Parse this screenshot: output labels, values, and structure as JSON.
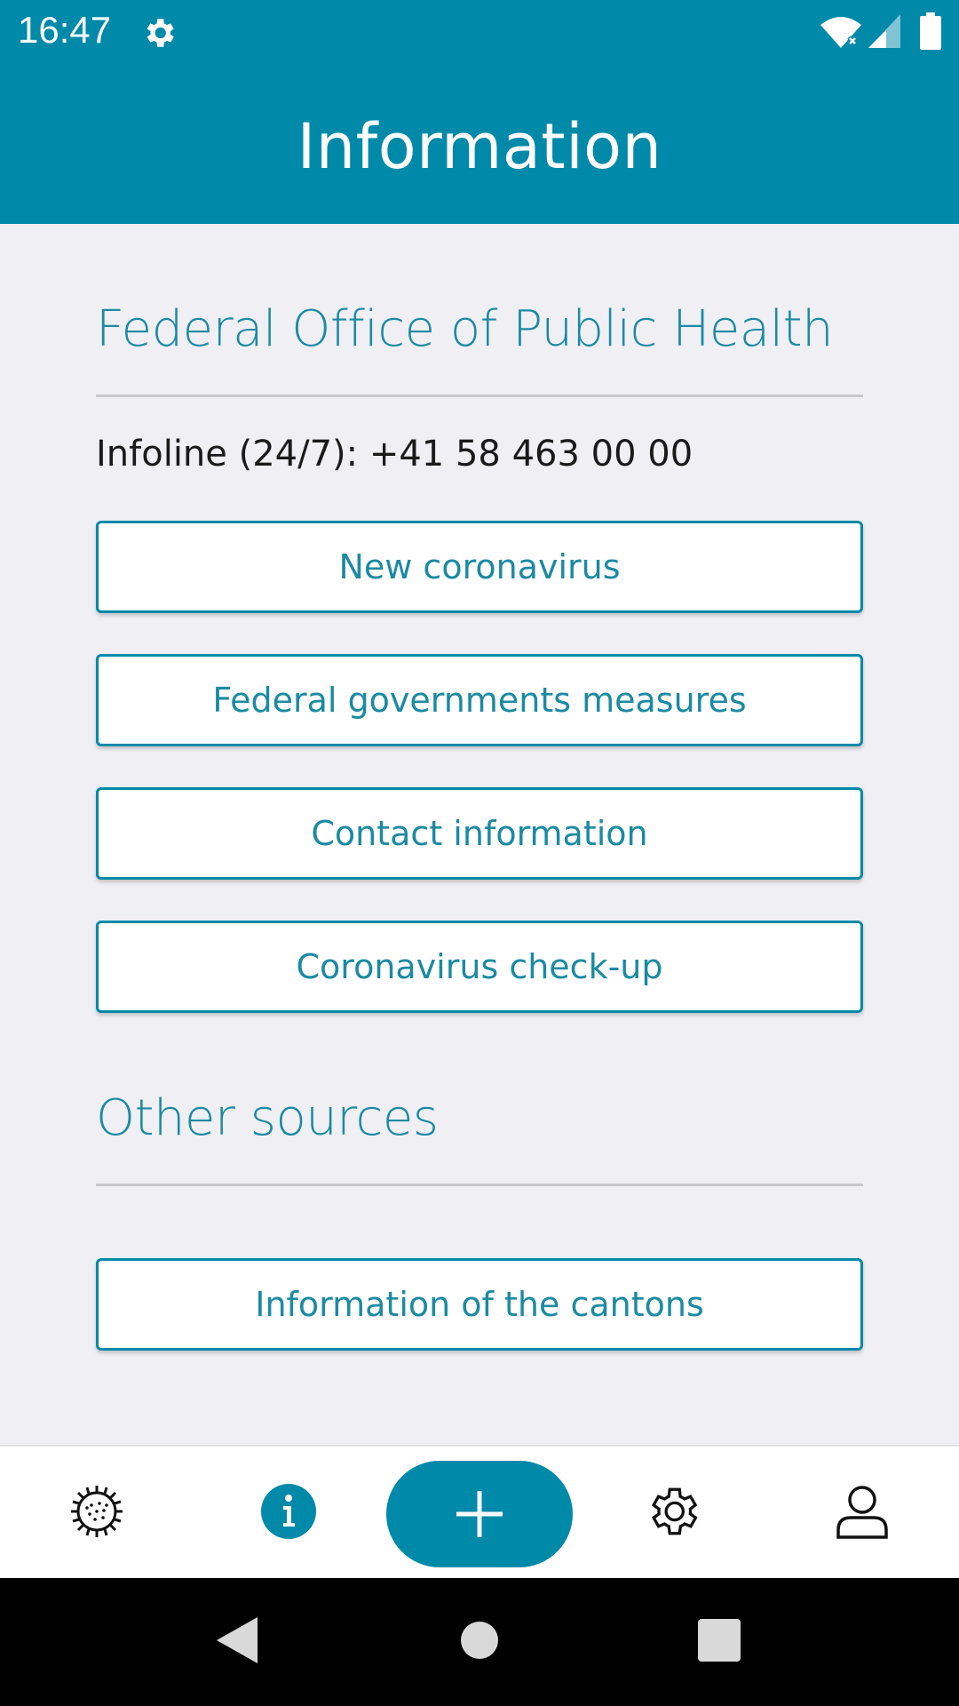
{
  "status_bar": {
    "time": "16:47",
    "icons": [
      "gear-icon",
      "wifi-icon",
      "signal-icon",
      "battery-icon"
    ]
  },
  "app_bar": {
    "title": "Information"
  },
  "federal_office": {
    "title": "Federal Office of Public Health",
    "infoline": "Infoline (24/7): +41 58 463 00 00",
    "buttons": [
      "New coronavirus",
      "Federal governments measures",
      "Contact information",
      "Coronavirus check-up"
    ]
  },
  "other_sources": {
    "title": "Other sources",
    "buttons": [
      "Information of the cantons"
    ]
  },
  "bottom_nav": {
    "items": [
      "virus-icon",
      "info-icon",
      "plus-icon",
      "settings-icon",
      "profile-icon"
    ],
    "active": "info-icon"
  },
  "colors": {
    "primary": "#0089a8",
    "text_accent": "#1b8aa3",
    "background": "#efeff4"
  }
}
